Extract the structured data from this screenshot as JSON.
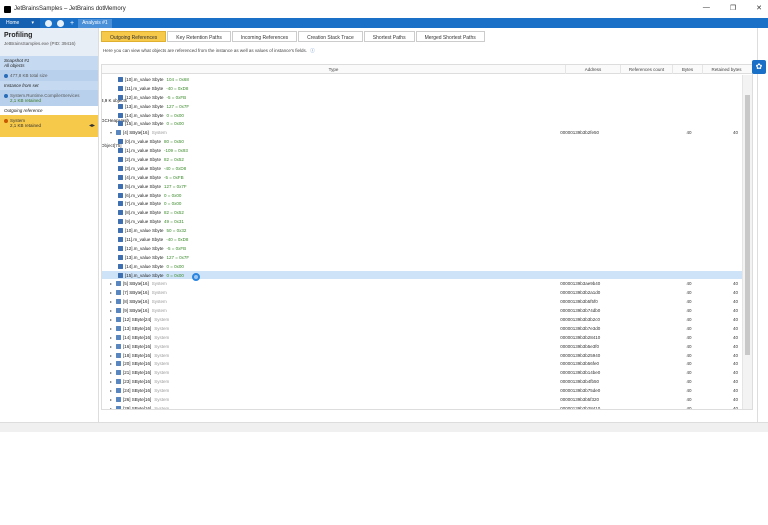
{
  "window": {
    "title": "JetBrainsSamples – JetBrains dotMemory",
    "controls": [
      "—",
      "❐",
      "✕"
    ]
  },
  "toolbar": {
    "home_label": "Home",
    "home_caret": "▾",
    "plus": "+",
    "analysis_tab": "Analysis #1"
  },
  "sidebar": {
    "title": "Profiling",
    "subtitle": "JetBrainsSamples.exe (PID: 39416)",
    "snapshot_label": "Snapshot #1",
    "snapshot_sub": "All objects",
    "snapshot_count": "3,9 K objects",
    "snapshot_size": "477,8 KB total size",
    "instance_label": "Instance from set",
    "instance_name": "GCHeapHash",
    "instance_ns": "System.Runtime.CompilerServices",
    "instance_retained": "2,1 KB retained",
    "outgoing_label": "Outgoing reference",
    "selected_name": "Object[75]",
    "selected_ns": "System",
    "selected_retained": "2,1 KB retained",
    "selected_arrow": "◂▸"
  },
  "tabs": [
    {
      "label": "Outgoing References",
      "active": true
    },
    {
      "label": "Key Retention Paths",
      "active": false
    },
    {
      "label": "Incoming References",
      "active": false
    },
    {
      "label": "Creation Stack Trace",
      "active": false
    },
    {
      "label": "Shortest Paths",
      "active": false
    },
    {
      "label": "Merged Shortest Paths",
      "active": false
    }
  ],
  "description": "Here you can view what objects are referenced from the instance as well as values of instance's fields.",
  "info_icon": "ⓘ",
  "table": {
    "headers": {
      "type": "Type",
      "address": "Address",
      "refs": "References count",
      "bytes": "Bytes",
      "retained": "Retained bytes"
    },
    "rows": [
      {
        "indent": 2,
        "kind": "field",
        "text": "[10].m_value  Sbyte",
        "val": "104 = 0x68"
      },
      {
        "indent": 2,
        "kind": "field",
        "text": "[11].m_value  Sbyte",
        "val": "-40 = 0xD8"
      },
      {
        "indent": 2,
        "kind": "field",
        "text": "[12].m_value  Sbyte",
        "val": "-5 = 0xFB"
      },
      {
        "indent": 2,
        "kind": "field",
        "text": "[13].m_value  Sbyte",
        "val": "127 = 0x7F"
      },
      {
        "indent": 2,
        "kind": "field",
        "text": "[14].m_value  Sbyte",
        "val": "0 = 0x00"
      },
      {
        "indent": 2,
        "kind": "field",
        "text": "[15].m_value  Sbyte",
        "val": "0 = 0x00"
      },
      {
        "indent": 1,
        "kind": "obj",
        "expanded": true,
        "text": "[4]  SByte[16]",
        "sys": "System",
        "addr": "00000139b3b2fe50",
        "bytes": "40",
        "ret": "40"
      },
      {
        "indent": 2,
        "kind": "field",
        "text": "[0].m_value  Sbyte",
        "val": "80 = 0x50"
      },
      {
        "indent": 2,
        "kind": "field",
        "text": "[1].m_value  Sbyte",
        "val": "-109 = 0x93"
      },
      {
        "indent": 2,
        "kind": "field",
        "text": "[2].m_value  Sbyte",
        "val": "82 = 0x52"
      },
      {
        "indent": 2,
        "kind": "field",
        "text": "[3].m_value  Sbyte",
        "val": "-40 = 0xD8"
      },
      {
        "indent": 2,
        "kind": "field",
        "text": "[4].m_value  Sbyte",
        "val": "-5 = 0xFB"
      },
      {
        "indent": 2,
        "kind": "field",
        "text": "[5].m_value  Sbyte",
        "val": "127 = 0x7F"
      },
      {
        "indent": 2,
        "kind": "field",
        "text": "[6].m_value  Sbyte",
        "val": "0 = 0x00"
      },
      {
        "indent": 2,
        "kind": "field",
        "text": "[7].m_value  Sbyte",
        "val": "0 = 0x00"
      },
      {
        "indent": 2,
        "kind": "field",
        "text": "[8].m_value  Sbyte",
        "val": "82 = 0x52"
      },
      {
        "indent": 2,
        "kind": "field",
        "text": "[9].m_value  Sbyte",
        "val": "49 = 0x31"
      },
      {
        "indent": 2,
        "kind": "field",
        "text": "[10].m_value  Sbyte",
        "val": "50 = 0x32"
      },
      {
        "indent": 2,
        "kind": "field",
        "text": "[11].m_value  Sbyte",
        "val": "-40 = 0xD8"
      },
      {
        "indent": 2,
        "kind": "field",
        "text": "[12].m_value  Sbyte",
        "val": "-5 = 0xFB"
      },
      {
        "indent": 2,
        "kind": "field",
        "text": "[13].m_value  Sbyte",
        "val": "127 = 0x7F"
      },
      {
        "indent": 2,
        "kind": "field",
        "text": "[14].m_value  Sbyte",
        "val": "0 = 0x00"
      },
      {
        "indent": 2,
        "kind": "field",
        "selected": true,
        "text": "[15].m_value  Sbyte",
        "val": "0 = 0x00"
      },
      {
        "indent": 1,
        "kind": "obj",
        "text": "[5]  SByte[16]",
        "sys": "System",
        "addr": "00000139b3ae9b40",
        "bytes": "40",
        "ret": "40"
      },
      {
        "indent": 1,
        "kind": "obj",
        "text": "[7]  SByte[16]",
        "sys": "System",
        "addr": "00000139b3b2a1d0",
        "bytes": "40",
        "ret": "40"
      },
      {
        "indent": 1,
        "kind": "obj",
        "text": "[8]  SByte[16]",
        "sys": "System",
        "addr": "00000139b3b5f5f0",
        "bytes": "40",
        "ret": "40"
      },
      {
        "indent": 1,
        "kind": "obj",
        "text": "[9]  SByte[16]",
        "sys": "System",
        "addr": "00000139b3b74db0",
        "bytes": "40",
        "ret": "40"
      },
      {
        "indent": 1,
        "kind": "obj",
        "text": "[12]  SByte[24]",
        "sys": "System",
        "addr": "00000139b3b3b2c0",
        "bytes": "40",
        "ret": "40"
      },
      {
        "indent": 1,
        "kind": "obj",
        "text": "[13]  SByte[16]",
        "sys": "System",
        "addr": "00000139b3b7e3d0",
        "bytes": "40",
        "ret": "40"
      },
      {
        "indent": 1,
        "kind": "obj",
        "text": "[14]  SByte[16]",
        "sys": "System",
        "addr": "00000139b3b28410",
        "bytes": "40",
        "ret": "40"
      },
      {
        "indent": 1,
        "kind": "obj",
        "text": "[16]  SByte[16]",
        "sys": "System",
        "addr": "00000139b3b5e3f0",
        "bytes": "40",
        "ret": "40"
      },
      {
        "indent": 1,
        "kind": "obj",
        "text": "[18]  SByte[16]",
        "sys": "System",
        "addr": "00000139b3b25940",
        "bytes": "40",
        "ret": "40"
      },
      {
        "indent": 1,
        "kind": "obj",
        "text": "[20]  SByte[16]",
        "sys": "System",
        "addr": "00000139b3b56fe0",
        "bytes": "40",
        "ret": "40"
      },
      {
        "indent": 1,
        "kind": "obj",
        "text": "[21]  SByte[16]",
        "sys": "System",
        "addr": "00000139b3b14be0",
        "bytes": "40",
        "ret": "40"
      },
      {
        "indent": 1,
        "kind": "obj",
        "text": "[23]  SByte[16]",
        "sys": "System",
        "addr": "00000139b3b4fb50",
        "bytes": "40",
        "ret": "40"
      },
      {
        "indent": 1,
        "kind": "obj",
        "text": "[24]  SByte[16]",
        "sys": "System",
        "addr": "00000139b3b75de0",
        "bytes": "40",
        "ret": "40"
      },
      {
        "indent": 1,
        "kind": "obj",
        "text": "[26]  SByte[16]",
        "sys": "System",
        "addr": "00000139b3b5f320",
        "bytes": "40",
        "ret": "40"
      },
      {
        "indent": 1,
        "kind": "obj",
        "text": "[29]  SByte[16]",
        "sys": "System",
        "addr": "00000139b3b28410",
        "bytes": "40",
        "ret": "40"
      }
    ]
  },
  "colors": {
    "accent": "#1a70c7",
    "selected_tab": "#f7c94a",
    "value_green": "#3a8a2a",
    "row_selected": "#cfe3f8"
  }
}
